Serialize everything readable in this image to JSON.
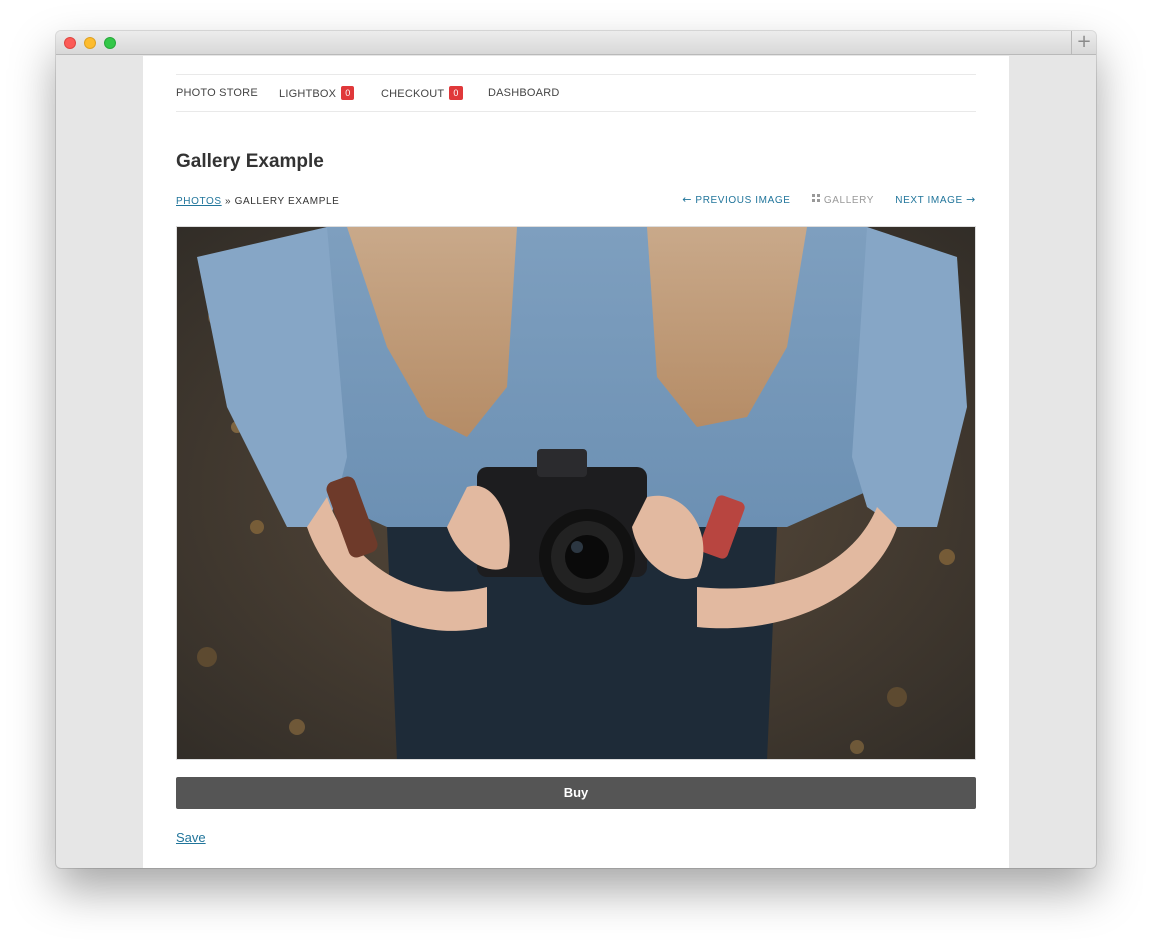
{
  "nav": {
    "items": [
      {
        "label": "PHOTO STORE"
      },
      {
        "label": "LIGHTBOX",
        "badge": "0"
      },
      {
        "label": "CHECKOUT",
        "badge": "0"
      },
      {
        "label": "DASHBOARD"
      }
    ]
  },
  "page": {
    "title": "Gallery Example"
  },
  "breadcrumb": {
    "root": "PHOTOS",
    "separator": "»",
    "current": "GALLERY EXAMPLE"
  },
  "pager": {
    "previous": "PREVIOUS IMAGE",
    "gallery": "GALLERY",
    "next": "NEXT IMAGE"
  },
  "actions": {
    "buy_label": "Buy",
    "save_label": "Save"
  },
  "colors": {
    "link": "#21759b",
    "badge": "#e0383a",
    "button": "#555555"
  }
}
